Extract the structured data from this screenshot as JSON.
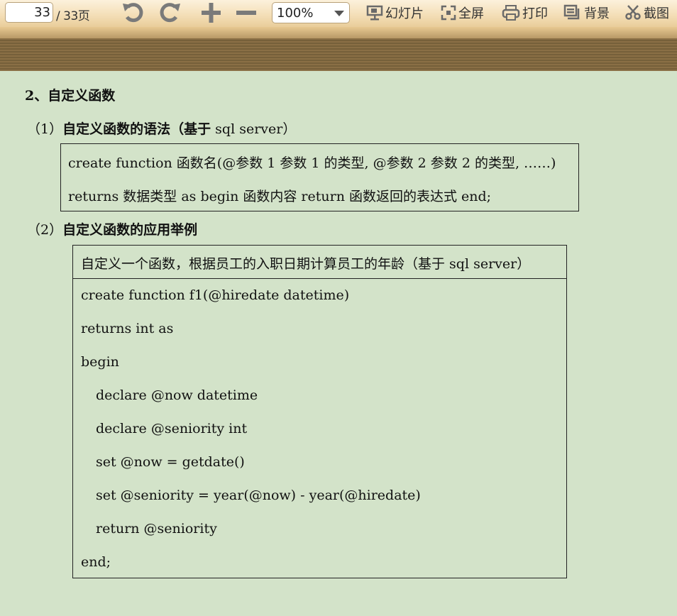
{
  "toolbar": {
    "current_page": "33",
    "total_pages": "/ 33页",
    "zoom": "100%",
    "slideshow_label": "幻灯片",
    "fullscreen_label": "全屏",
    "print_label": "打印",
    "background_label": "背景",
    "screenshot_label": "截图"
  },
  "document": {
    "section_title": "2、自定义函数",
    "sub1_prefix": "（1）",
    "sub1_title": "自定义函数的语法（",
    "sub1_title_b": "基于",
    "sub1_tail": " sql server）",
    "syntax_lines": [
      "create function  函数名(@参数 1 参数 1 的类型, @参数 2  参数 2 的类型,  ……)",
      "returns  数据类型  as begin  函数内容  return  函数返回的表达式 end;"
    ],
    "sub2_prefix": "（2）",
    "sub2_title": "自定义函数的应用举例",
    "example_caption": "自定义一个函数，根据员工的入职日期计算员工的年龄（基于 sql server）",
    "example_lines": [
      "create function f1(@hiredate datetime)",
      "returns int as",
      "begin",
      "declare @now datetime",
      "declare @seniority int",
      "set @now = getdate()",
      "set @seniority = year(@now) - year(@hiredate)",
      "return @seniority",
      "end;"
    ]
  }
}
